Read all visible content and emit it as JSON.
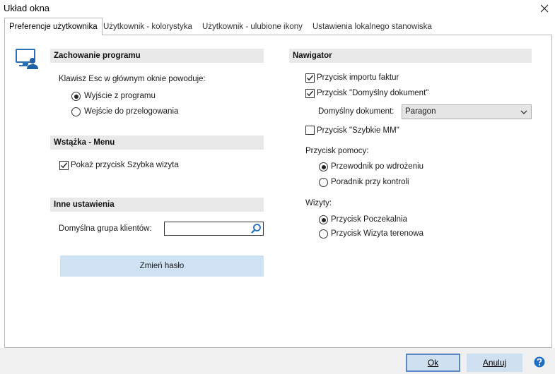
{
  "window": {
    "title": "Układ okna"
  },
  "tabs": [
    {
      "label": "Preferencje użytkownika"
    },
    {
      "label": "Użytkownik - kolorystyka"
    },
    {
      "label": "Użytkownik - ulubione ikony"
    },
    {
      "label": "Ustawienia lokalnego stanowiska"
    }
  ],
  "left": {
    "program": {
      "title": "Zachowanie programu",
      "esc_label": "Klawisz Esc w głównym oknie powoduje:",
      "options": [
        {
          "label": "Wyjście z programu",
          "selected": true
        },
        {
          "label": "Wejście do przelogowania",
          "selected": false
        }
      ]
    },
    "ribbon": {
      "title": "Wstążka - Menu",
      "show_quick_visit": {
        "label": "Pokaż przycisk Szybka wizyta",
        "checked": true
      }
    },
    "other": {
      "title": "Inne ustawienia",
      "default_group_label": "Domyślna grupa klientów:",
      "default_group_value": ""
    },
    "change_password_label": "Zmień hasło"
  },
  "navigator": {
    "title": "Nawigator",
    "import_invoices": {
      "label": "Przycisk importu faktur",
      "checked": true
    },
    "default_document_btn": {
      "label": "Przycisk \"Domyślny dokument\"",
      "checked": true
    },
    "default_document": {
      "label": "Domyślny dokument:",
      "value": "Paragon"
    },
    "quick_mm": {
      "label": "Przycisk \"Szybkie MM\"",
      "checked": false
    },
    "help_button": {
      "label": "Przycisk pomocy:",
      "options": [
        {
          "label": "Przewodnik po wdrożeniu",
          "selected": true
        },
        {
          "label": "Poradnik przy kontroli",
          "selected": false
        }
      ]
    },
    "visits": {
      "label": "Wizyty:",
      "options": [
        {
          "label": "Przycisk Poczekalnia",
          "selected": true
        },
        {
          "label": "Przycisk Wizyta terenowa",
          "selected": false
        }
      ]
    }
  },
  "footer": {
    "ok_label": "Ok",
    "cancel_label": "Anuluj"
  },
  "colors": {
    "accent": "#5d87c2",
    "button_bg": "#cfe0f1",
    "help_blue": "#1f6fc5"
  }
}
